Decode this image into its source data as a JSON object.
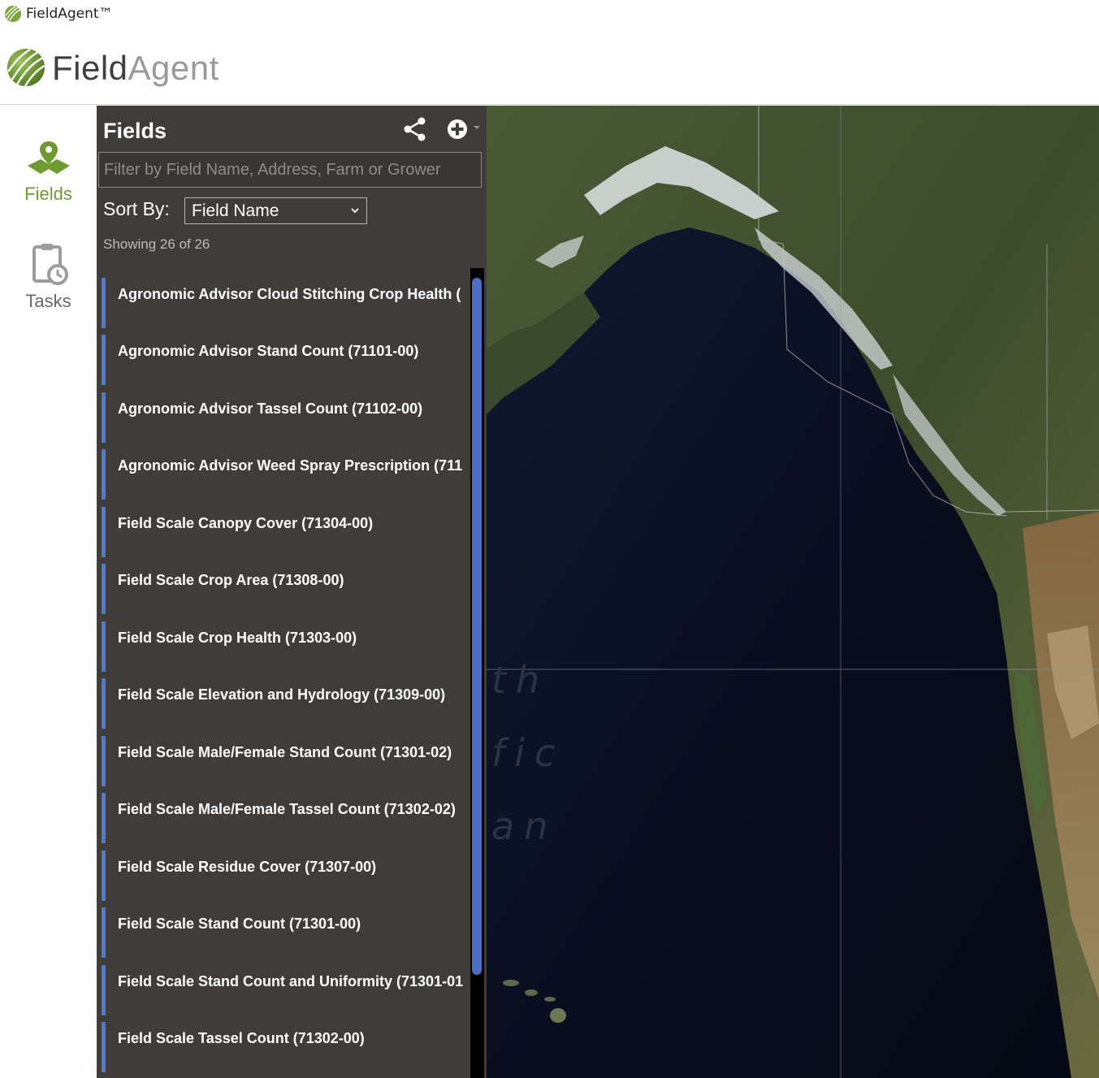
{
  "window": {
    "title": "FieldAgent™"
  },
  "brand": {
    "logo_part1": "Field",
    "logo_part2": "Agent"
  },
  "nav": {
    "fields_label": "Fields",
    "tasks_label": "Tasks"
  },
  "panel": {
    "title": "Fields",
    "filter_placeholder": "Filter by Field Name, Address, Farm or Grower",
    "sort_label": "Sort By:",
    "sort_value": "Field Name",
    "showing": "Showing 26 of 26",
    "items": [
      "Agronomic Advisor Cloud Stitching Crop Health (",
      "Agronomic Advisor Stand Count (71101-00)",
      "Agronomic Advisor Tassel Count (71102-00)",
      "Agronomic Advisor Weed Spray Prescription (711",
      "Field Scale Canopy Cover (71304-00)",
      "Field Scale Crop Area (71308-00)",
      "Field Scale Crop Health (71303-00)",
      "Field Scale Elevation and Hydrology (71309-00)",
      "Field Scale Male/Female Stand Count (71301-02)",
      "Field Scale Male/Female Tassel Count (71302-02)",
      "Field Scale Residue Cover (71307-00)",
      "Field Scale Stand Count (71301-00)",
      "Field Scale Stand Count and Uniformity (71301-01",
      "Field Scale Tassel Count (71302-00)"
    ]
  },
  "map": {
    "labels": [
      "th",
      "fic",
      "an"
    ]
  },
  "colors": {
    "brand_green": "#6e9a31",
    "panel_bg": "#403c3a",
    "accent_blue": "#4f7ad1"
  }
}
